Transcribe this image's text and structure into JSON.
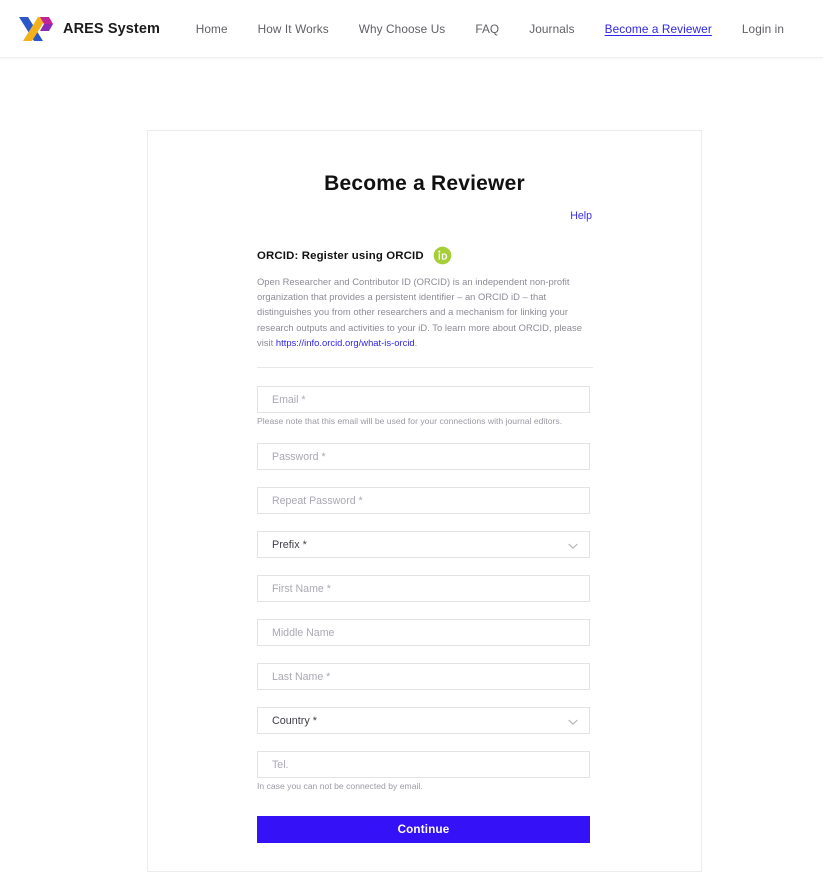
{
  "header": {
    "brand_name": "ARES System",
    "logo_colors": {
      "blue": "#2b4dc7",
      "yellow": "#f5b battery",
      "magenta": "#c2239b"
    },
    "nav": [
      {
        "label": "Home",
        "active": false
      },
      {
        "label": "How It Works",
        "active": false
      },
      {
        "label": "Why Choose Us",
        "active": false
      },
      {
        "label": "FAQ",
        "active": false
      },
      {
        "label": "Journals",
        "active": false
      },
      {
        "label": "Become a Reviewer",
        "active": true
      },
      {
        "label": "Login in",
        "active": false
      }
    ]
  },
  "card": {
    "title": "Become a Reviewer",
    "help_label": "Help",
    "orcid": {
      "label": "ORCID:  Register using ORCID",
      "icon_name": "orcid-id-icon",
      "description_part1": "Open Researcher and Contributor ID (ORCID) is an independent non-profit organization that provides a persistent identifier – an ORCID iD – that distinguishes you from other researchers and a mechanism for linking your research outputs and activities to your iD. To learn more about ORCID, please visit ",
      "description_link": "https://info.orcid.org/what-is-orcid",
      "description_part2": "."
    },
    "fields": {
      "email_placeholder": "Email *",
      "email_value": "",
      "email_hint": "Please note that this email will be used for your connections with journal editors.",
      "password_placeholder": "Password *",
      "password_value": "",
      "repeat_password_placeholder": "Repeat Password *",
      "repeat_password_value": "",
      "prefix_label": "Prefix *",
      "first_name_placeholder": "First Name *",
      "first_name_value": "",
      "middle_name_placeholder": "Middle Name",
      "middle_name_value": "",
      "last_name_placeholder": "Last Name *",
      "last_name_value": "",
      "country_label": "Country *",
      "tel_placeholder": "Tel.",
      "tel_value": "",
      "tel_hint": "In case you can not be connected by email."
    },
    "continue_label": "Continue",
    "accent_color": "#3411f7"
  }
}
